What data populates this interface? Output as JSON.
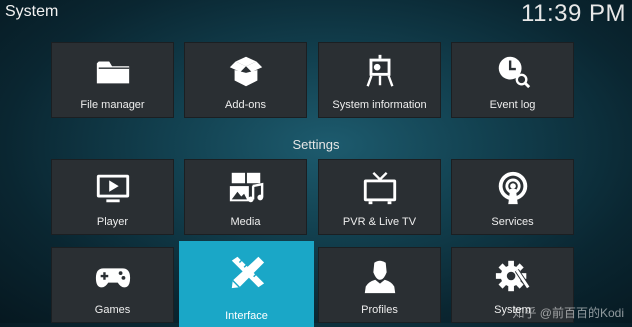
{
  "header": {
    "title": "System",
    "clock": "11:39 PM"
  },
  "row1": [
    {
      "label": "File manager",
      "icon": "folder-icon"
    },
    {
      "label": "Add-ons",
      "icon": "open-box-icon"
    },
    {
      "label": "System information",
      "icon": "presentation-board-icon"
    },
    {
      "label": "Event log",
      "icon": "clock-search-icon"
    }
  ],
  "section": {
    "label": "Settings"
  },
  "row2": [
    {
      "label": "Player",
      "icon": "tv-play-icon"
    },
    {
      "label": "Media",
      "icon": "media-images-music-icon"
    },
    {
      "label": "PVR & Live TV",
      "icon": "retro-tv-icon"
    },
    {
      "label": "Services",
      "icon": "broadcast-icon"
    }
  ],
  "row3": [
    {
      "label": "Games",
      "icon": "gamepad-icon"
    },
    {
      "label": "Interface",
      "icon": "pencil-ruler-icon",
      "focused": true
    },
    {
      "label": "Profiles",
      "icon": "user-silhouette-icon"
    },
    {
      "label": "System",
      "icon": "gear-wrench-icon"
    }
  ],
  "watermark": "知乎 @前百百的Kodi",
  "colors": {
    "focus": "#1aa7c7",
    "tile": "#2a2f33",
    "background": "#0f3a48"
  }
}
